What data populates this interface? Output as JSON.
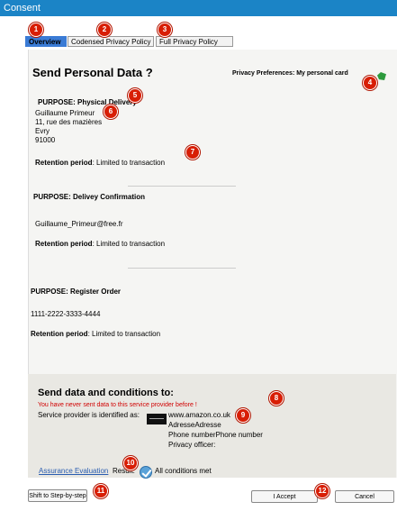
{
  "window": {
    "title": "Consent"
  },
  "tabs": [
    {
      "label": "Overview",
      "badge": "1"
    },
    {
      "label": "Codensed Privacy Policy",
      "badge": "2"
    },
    {
      "label": "Full Privacy Policy",
      "badge": "3"
    }
  ],
  "header": {
    "title": "Send Personal Data ?",
    "preferences_label": "Privacy Preferences: My personal card",
    "card_badge": "4"
  },
  "purposes": [
    {
      "title": "PURPOSE: Physical Delivery",
      "badge_title": "5",
      "badge_data": "6",
      "badge_retention": "7",
      "lines": [
        "Guillaume Primeur",
        "11, rue des mazières",
        "Evry",
        "91000"
      ],
      "retention_label": "Retention period",
      "retention_value": ": Limited to transaction"
    },
    {
      "title": "PURPOSE: Delivey Confirmation",
      "lines": [
        "Guillaume_Primeur@free.fr"
      ],
      "retention_label": "Retention period",
      "retention_value": ": Limited to transaction"
    },
    {
      "title": "PURPOSE: Register Order",
      "lines": [
        "1111-2222-3333-4444"
      ],
      "retention_label": "Retention period",
      "retention_value": ": Limited to transaction"
    }
  ],
  "conditions": {
    "title": "Send data and conditions to:",
    "warning": "You have never sent data to this service provider before !",
    "identified_label": "Service provider is identified as:",
    "provider_url": "www.amazon.co.uk",
    "address": "AdresseAdresse",
    "phone": "Phone numberPhone number",
    "officer": "Privacy officer:",
    "badge_warning": "8",
    "badge_provider": "9"
  },
  "assurance": {
    "link": "Assurance Evaluation",
    "result_label": "Result:",
    "result_value": "All conditions met",
    "badge": "10"
  },
  "buttons": {
    "step_label": "Shift to Step-by-step",
    "step_badge": "11",
    "accept_label": "I Accept",
    "accept_badge": "12",
    "cancel_label": "Cancel"
  },
  "colors": {
    "titlebar": "#1b84c6",
    "active_tab": "#3a7bd5",
    "badge": "#d81e05",
    "warning_text": "#d00000",
    "link": "#2a5db0"
  }
}
